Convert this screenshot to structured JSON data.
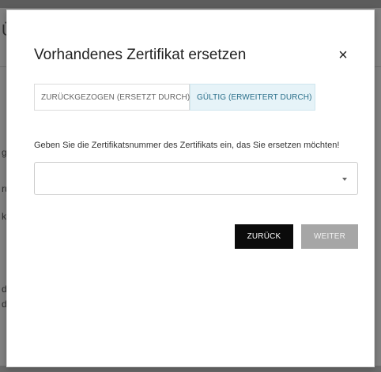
{
  "background": {
    "fragments": [
      "Ü",
      "g",
      "ru",
      "k",
      "de",
      "d"
    ]
  },
  "modal": {
    "title": "Vorhandenes Zertifikat ersetzen",
    "close_symbol": "×",
    "tabs": [
      {
        "label": "ZURÜCKGEZOGEN (ERSETZT DURCH)",
        "active": false
      },
      {
        "label": "GÜLTIG (ERWEITERT DURCH)",
        "active": true
      }
    ],
    "instruction": "Geben Sie die Zertifikatsnummer des Zertifikats ein, das Sie ersetzen möchten!",
    "certificate_select": {
      "value": ""
    },
    "buttons": {
      "back_label": "ZURÜCK",
      "next_label": "WEITER"
    }
  },
  "colors": {
    "active_tab_bg": "#e6f3f8",
    "active_tab_text": "#2a6f8a",
    "primary_button": "#0b0b0b",
    "disabled_button": "#a6a6a6",
    "overlay": "#808080"
  }
}
